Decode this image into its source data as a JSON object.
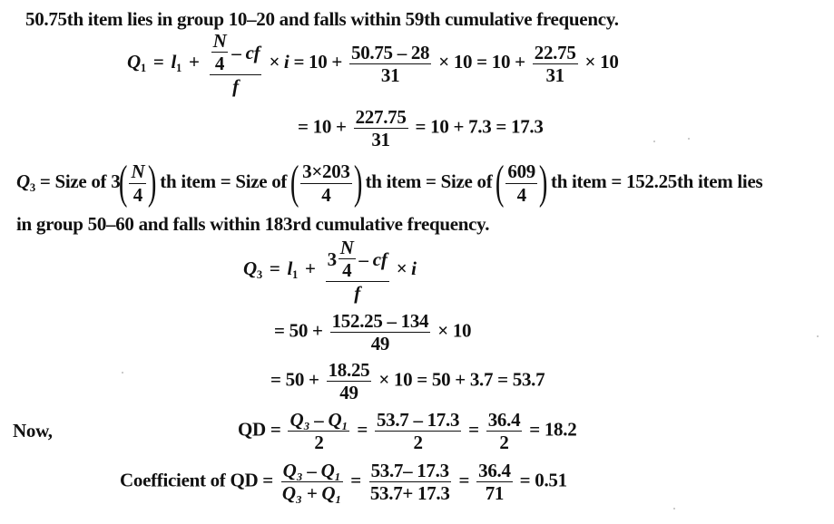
{
  "intro": {
    "text": "50.75th item lies in group 10–20 and falls within 59th cumulative frequency."
  },
  "q1": {
    "lhs": "Q",
    "lhs_sub": "1",
    "l": "l",
    "l_sub": "1",
    "formula_num_top": "N",
    "formula_num_bottom": "4",
    "formula_num_rest": "– cf",
    "formula_den": "f",
    "times_i": "× i =",
    "step1_base": "10 +",
    "step1_num": "50.75 – 28",
    "step1_den": "31",
    "step1_tail": "× 10 = 10 +",
    "step2_num": "22.75",
    "step2_den": "31",
    "step2_tail": "× 10",
    "line2_base": "= 10 +",
    "line2_num": "227.75",
    "line2_den": "31",
    "line2_tail": "= 10 + 7.3 = 17.3"
  },
  "q3_def": {
    "lhs": "Q",
    "lhs_sub": "3",
    "part1": "= Size of 3",
    "f1_num": "N",
    "f1_den": "4",
    "part2": "th item = Size of",
    "f2_num": "3×203",
    "f2_den": "4",
    "part3": "th item = Size of",
    "f3_num": "609",
    "f3_den": "4",
    "part4": "th item = 152.25th item lies",
    "line2": "in group 50–60 and falls within 183rd cumulative frequency."
  },
  "q3": {
    "lhs": "Q",
    "lhs_sub": "3",
    "l": "l",
    "l_sub": "1",
    "formula_coef": "3",
    "formula_num_top": "N",
    "formula_num_bottom": "4",
    "formula_num_rest": "– cf",
    "formula_den": "f",
    "times_i": "× i",
    "line2_base": "= 50 +",
    "line2_num": "152.25 – 134",
    "line2_den": "49",
    "line2_tail": "× 10",
    "line3_base": "= 50 +",
    "line3_num": "18.25",
    "line3_den": "49",
    "line3_tail": "× 10 = 50 + 3.7 = 53.7"
  },
  "qd": {
    "now_label": "Now,",
    "label": "QD =",
    "f1_num": "Q₃ – Q₁",
    "f1_den": "2",
    "f2_num": "53.7 – 17.3",
    "f2_den": "2",
    "f3_num": "36.4",
    "f3_den": "2",
    "result": "= 18.2"
  },
  "coef_qd": {
    "label": "Coefficient of QD =",
    "f1_num": "Q₃ – Q₁",
    "f1_den": "Q₃ + Q₁",
    "f2_num": "53.7– 17.3",
    "f2_den": "53.7+ 17.3",
    "f3_num": "36.4",
    "f3_den": "71",
    "result": "= 0.51"
  },
  "eq": "="
}
